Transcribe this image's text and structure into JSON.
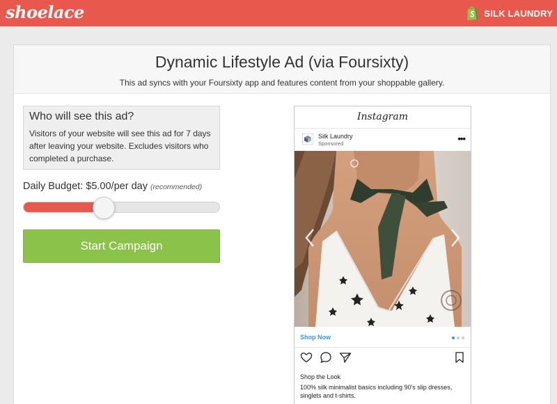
{
  "header": {
    "logo_text": "shoelace",
    "store_name": "SILK LAUNDRY",
    "store_icon": "shopify-bag-icon",
    "brand_color": "#e8584c"
  },
  "page": {
    "title": "Dynamic Lifestyle Ad (via Foursixty)",
    "subtitle": "This ad syncs with your Foursixty app and features content from your shoppable gallery."
  },
  "audience": {
    "title": "Who will see this ad?",
    "body": "Visitors of your website will see this ad for 7 days after leaving your website. Excludes visitors who completed a purchase."
  },
  "budget": {
    "label": "Daily Budget: $5.00/per day",
    "recommended": "(recommended)",
    "slider_fraction": 0.41,
    "slider_color": "#e8584c"
  },
  "cta": {
    "label": "Start Campaign",
    "color": "#8bc34a"
  },
  "instagram": {
    "brand": "Instagram",
    "username": "Silk Laundry",
    "sponsored": "Sponsored",
    "more_icon": "more-dots-icon",
    "shop_link": "Shop Now",
    "carousel_dots": 3,
    "carousel_active": 0,
    "caption_title": "Shop the Look",
    "caption_body": "100% silk minimalist basics including 90's slip dresses, singlets and t-shirts.",
    "link_color": "#3897f0",
    "action_icons": [
      "heart-icon",
      "comment-icon",
      "share-icon",
      "bookmark-icon"
    ]
  }
}
